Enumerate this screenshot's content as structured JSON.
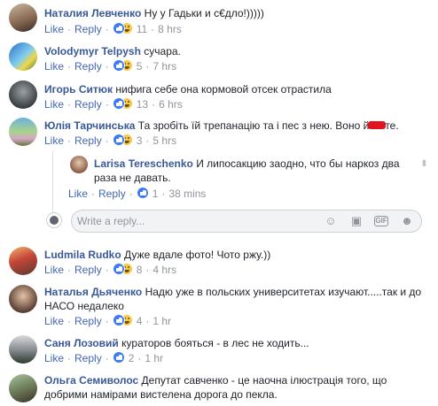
{
  "ui": {
    "like": "Like",
    "reply": "Reply",
    "sep": "·",
    "reply_placeholder": "Write a reply..."
  },
  "comments": [
    {
      "author": "Наталия Левченко",
      "text": "Ну у Гадьки и с€дло!)))))",
      "count": "11",
      "time": "8 hrs"
    },
    {
      "author": "Volodymyr Telpysh",
      "text": "сучара.",
      "count": "5",
      "time": "7 hrs"
    },
    {
      "author": "Игорь Ситюк",
      "text": "нифига себе она кормовой отсек отрастила",
      "count": "13",
      "time": "6 hrs"
    },
    {
      "author": "Юлія Тарчинська",
      "text_before": "Та зробіть їй трепанацію та і пес з нею. Воно й",
      "text_after": "те.",
      "count": "3",
      "time": "5 hrs"
    },
    {
      "author": "Ludmila Rudko",
      "text": "Дуже вдале фото! Чото ржу.))",
      "count": "8",
      "time": "4 hrs"
    },
    {
      "author": "Наталья Дьяченко",
      "text": "Надю уже в польских университетах изучают.....так и до НАСО недалеко",
      "count": "4",
      "time": "1 hr"
    },
    {
      "author": "Саня Лозовий",
      "text": "кураторов бояться - в лес не ходить...",
      "count": "2",
      "time": "1 hr"
    },
    {
      "author": "Ольга Семиволос",
      "text": "Депутат савченко - це наочна ілюстрація того, що добрими намірами вистелена дорога до пекла."
    }
  ],
  "reply": {
    "author": "Larisa Tereschenko",
    "text": "И липосакцию заодно, что бы наркоз два раза не давать.",
    "count": "1",
    "time": "38 mins"
  },
  "icons": {
    "like": "like-reaction-icon",
    "haha": "haha-reaction-icon",
    "emoji": "emoji-icon",
    "camera": "camera-icon",
    "gif": "gif-icon",
    "sticker": "sticker-icon",
    "edit": "more-options-icon"
  }
}
